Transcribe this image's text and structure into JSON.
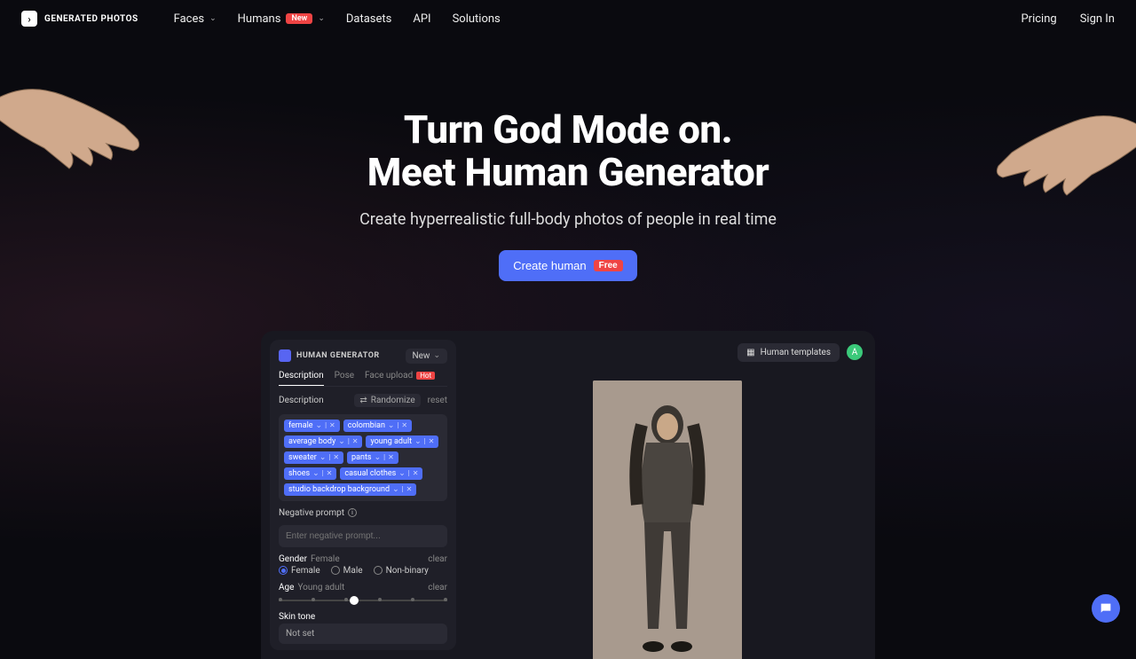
{
  "nav": {
    "brand": "GENERATED PHOTOS",
    "links": [
      "Faces",
      "Humans",
      "Datasets",
      "API",
      "Solutions"
    ],
    "badge_new": "New",
    "pricing": "Pricing",
    "signin": "Sign In"
  },
  "hero": {
    "line1": "Turn God Mode on.",
    "line2": "Meet Human Generator",
    "sub": "Create hyperrealistic full-body photos of people in real time",
    "cta": "Create human",
    "cta_badge": "Free"
  },
  "app": {
    "title": "HUMAN GENERATOR",
    "new_btn": "New",
    "tabs": [
      "Description",
      "Pose",
      "Face upload"
    ],
    "hot": "Hot",
    "desc_label": "Description",
    "randomize": "Randomize",
    "reset": "reset",
    "tags": [
      "female",
      "colombian",
      "average body",
      "young adult",
      "sweater",
      "pants",
      "shoes",
      "casual clothes",
      "studio backdrop background"
    ],
    "neg_label": "Negative prompt",
    "neg_placeholder": "Enter negative prompt...",
    "gender_label": "Gender",
    "gender_val": "Female",
    "gender_opts": [
      "Female",
      "Male",
      "Non-binary"
    ],
    "age_label": "Age",
    "age_val": "Young adult",
    "skin_label": "Skin tone",
    "skin_val": "Not set",
    "clear": "clear",
    "templates": "Human templates",
    "avatar": "A"
  }
}
